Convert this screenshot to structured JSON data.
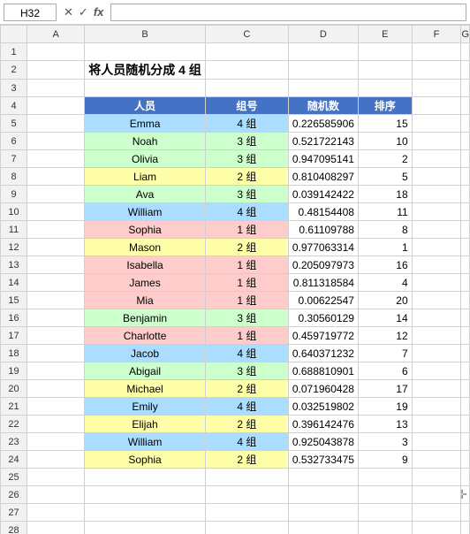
{
  "formulaBar": {
    "nameBox": "H32",
    "cancelIcon": "✕",
    "confirmIcon": "✓",
    "functionIcon": "fx"
  },
  "title": "将人员随机分成 4 组",
  "headers": [
    "人员",
    "组号",
    "随机数",
    "排序"
  ],
  "rows": [
    {
      "name": "Emma",
      "group": "4 组",
      "grpClass": "grp4",
      "random": "0.226585906",
      "rank": "15"
    },
    {
      "name": "Noah",
      "group": "3 组",
      "grpClass": "grp3",
      "random": "0.521722143",
      "rank": "10"
    },
    {
      "name": "Olivia",
      "group": "3 组",
      "grpClass": "grp3",
      "random": "0.947095141",
      "rank": "2"
    },
    {
      "name": "Liam",
      "group": "2 组",
      "grpClass": "grp2",
      "random": "0.810408297",
      "rank": "5"
    },
    {
      "name": "Ava",
      "group": "3 组",
      "grpClass": "grp3",
      "random": "0.039142422",
      "rank": "18"
    },
    {
      "name": "William",
      "group": "4 组",
      "grpClass": "grp4",
      "random": "0.48154408",
      "rank": "11"
    },
    {
      "name": "Sophia",
      "group": "1 组",
      "grpClass": "grp1",
      "random": "0.61109788",
      "rank": "8"
    },
    {
      "name": "Mason",
      "group": "2 组",
      "grpClass": "grp2",
      "random": "0.977063314",
      "rank": "1"
    },
    {
      "name": "Isabella",
      "group": "1 组",
      "grpClass": "grp1",
      "random": "0.205097973",
      "rank": "16"
    },
    {
      "name": "James",
      "group": "1 组",
      "grpClass": "grp1",
      "random": "0.811318584",
      "rank": "4"
    },
    {
      "name": "Mia",
      "group": "1 组",
      "grpClass": "grp1",
      "random": "0.00622547",
      "rank": "20"
    },
    {
      "name": "Benjamin",
      "group": "3 组",
      "grpClass": "grp3",
      "random": "0.30560129",
      "rank": "14"
    },
    {
      "name": "Charlotte",
      "group": "1 组",
      "grpClass": "grp1",
      "random": "0.459719772",
      "rank": "12"
    },
    {
      "name": "Jacob",
      "group": "4 组",
      "grpClass": "grp4",
      "random": "0.640371232",
      "rank": "7"
    },
    {
      "name": "Abigail",
      "group": "3 组",
      "grpClass": "grp3",
      "random": "0.688810901",
      "rank": "6"
    },
    {
      "name": "Michael",
      "group": "2 组",
      "grpClass": "grp2",
      "random": "0.071960428",
      "rank": "17"
    },
    {
      "name": "Emily",
      "group": "4 组",
      "grpClass": "grp4",
      "random": "0.032519802",
      "rank": "19"
    },
    {
      "name": "Elijah",
      "group": "2 组",
      "grpClass": "grp2",
      "random": "0.396142476",
      "rank": "13"
    },
    {
      "name": "William",
      "group": "4 组",
      "grpClass": "grp4",
      "random": "0.925043878",
      "rank": "3"
    },
    {
      "name": "Sophia",
      "group": "2 组",
      "grpClass": "grp2",
      "random": "0.532733475",
      "rank": "9"
    }
  ],
  "rowNumbers": [
    1,
    2,
    3,
    4,
    5,
    6,
    7,
    8,
    9,
    10,
    11,
    12,
    13,
    14,
    15,
    16,
    17,
    18,
    19,
    20,
    21,
    22,
    23,
    24,
    25,
    26,
    27,
    28
  ]
}
